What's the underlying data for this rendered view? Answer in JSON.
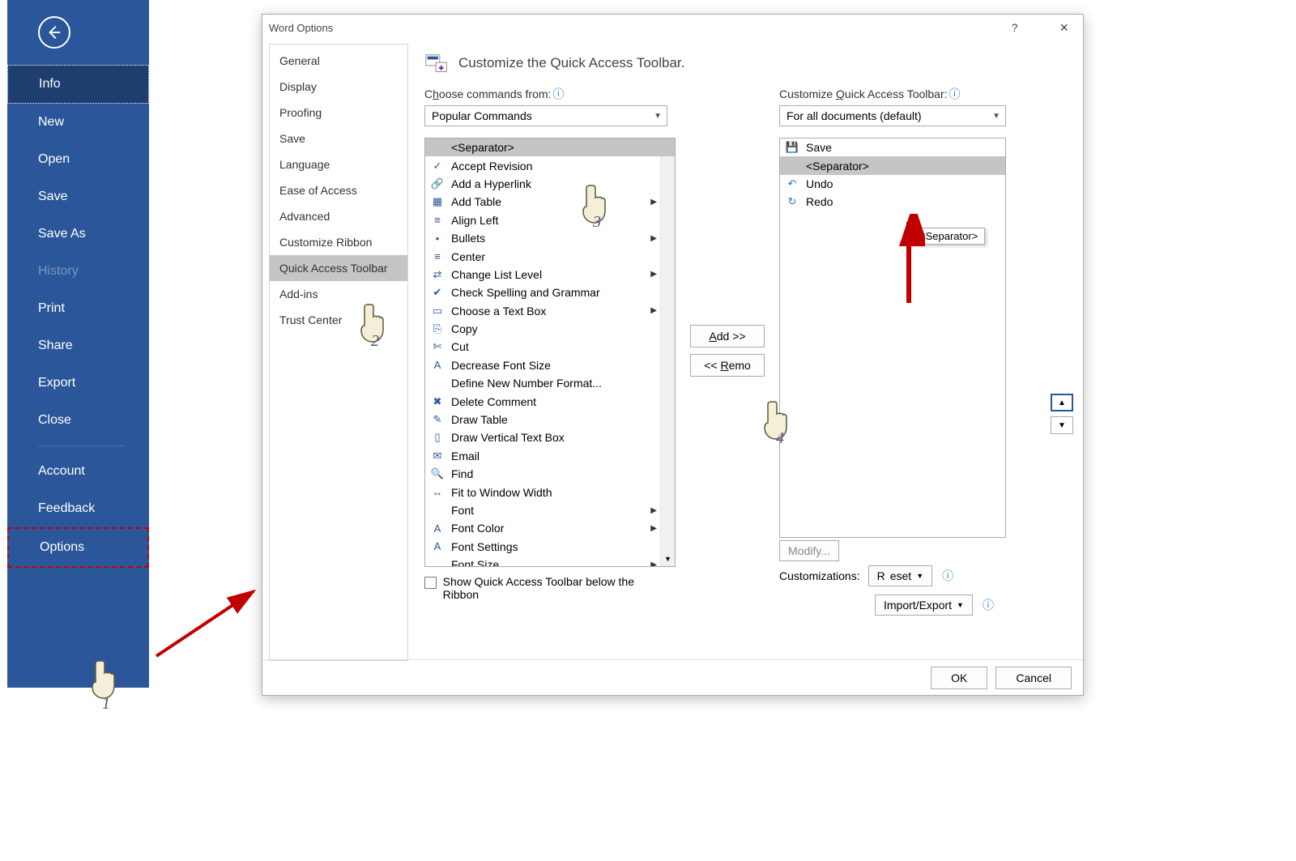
{
  "backstage": {
    "items": [
      "Info",
      "New",
      "Open",
      "Save",
      "Save As",
      "History",
      "Print",
      "Share",
      "Export",
      "Close"
    ],
    "disabled_index": 5,
    "selected_index": 0,
    "bottom": [
      "Account",
      "Feedback",
      "Options"
    ]
  },
  "dialog": {
    "title": "Word Options",
    "help": "?",
    "close": "×",
    "categories": [
      "General",
      "Display",
      "Proofing",
      "Save",
      "Language",
      "Ease of Access",
      "Advanced",
      "Customize Ribbon",
      "Quick Access Toolbar",
      "Add-ins",
      "Trust Center"
    ],
    "selected_category": 8,
    "heading": "Customize the Quick Access Toolbar.",
    "choose_label_pre": "C",
    "choose_label_u": "h",
    "choose_label_post": "oose commands from:",
    "choose_value": "Popular Commands",
    "customize_label_pre": "Customize ",
    "customize_label_u": "Q",
    "customize_label_post": "uick Access Toolbar:",
    "customize_value": "For all documents (default)",
    "left_list": [
      {
        "label": "<Separator>",
        "sep": true,
        "sel": true
      },
      {
        "label": "Accept Revision",
        "icon": "✓"
      },
      {
        "label": "Add a Hyperlink",
        "icon": "🔗"
      },
      {
        "label": "Add Table",
        "icon": "▦",
        "sub": true
      },
      {
        "label": "Align Left",
        "icon": "≡"
      },
      {
        "label": "Bullets",
        "icon": "•",
        "sub": true
      },
      {
        "label": "Center",
        "icon": "≡"
      },
      {
        "label": "Change List Level",
        "icon": "⇄",
        "sub": true
      },
      {
        "label": "Check Spelling and Grammar",
        "icon": "✔"
      },
      {
        "label": "Choose a Text Box",
        "icon": "▭",
        "sub": true
      },
      {
        "label": "Copy",
        "icon": "⎘"
      },
      {
        "label": "Cut",
        "icon": "✄"
      },
      {
        "label": "Decrease Font Size",
        "icon": "A"
      },
      {
        "label": "Define New Number Format...",
        "icon": ""
      },
      {
        "label": "Delete Comment",
        "icon": "✖"
      },
      {
        "label": "Draw Table",
        "icon": "✎"
      },
      {
        "label": "Draw Vertical Text Box",
        "icon": "▯"
      },
      {
        "label": "Email",
        "icon": "✉"
      },
      {
        "label": "Find",
        "icon": "🔍"
      },
      {
        "label": "Fit to Window Width",
        "icon": "↔"
      },
      {
        "label": "Font",
        "icon": "",
        "sub": true
      },
      {
        "label": "Font Color",
        "icon": "A",
        "sub": true
      },
      {
        "label": "Font Settings",
        "icon": "A"
      },
      {
        "label": "Font Size",
        "icon": "",
        "sub": true
      }
    ],
    "right_list": [
      {
        "label": "Save",
        "icon": "💾",
        "cls": "save"
      },
      {
        "label": "<Separator>",
        "sep": true,
        "sel": true
      },
      {
        "label": "Undo",
        "icon": "↶",
        "cls": "undo"
      },
      {
        "label": "Redo",
        "icon": "↻",
        "cls": "redo"
      }
    ],
    "tooltip": "<Separator>",
    "add_label_u": "A",
    "add_label_post": "dd >>",
    "remove_label_pre": "<< ",
    "remove_label_u": "R",
    "remove_label_post": "emo",
    "modify_label_u": "M",
    "modify_label_post": "odify...",
    "customizations": "Customizations:",
    "reset_label": "Reset",
    "import_label": "Import/Export",
    "checkbox_label_pre": "S",
    "checkbox_label_u": "h",
    "checkbox_label_post": "ow Quick Access Toolbar below the Ribbon",
    "ok": "OK",
    "cancel": "Cancel"
  },
  "annotations": {
    "n1": "1",
    "n2": "2",
    "n3": "3",
    "n4": "4"
  }
}
